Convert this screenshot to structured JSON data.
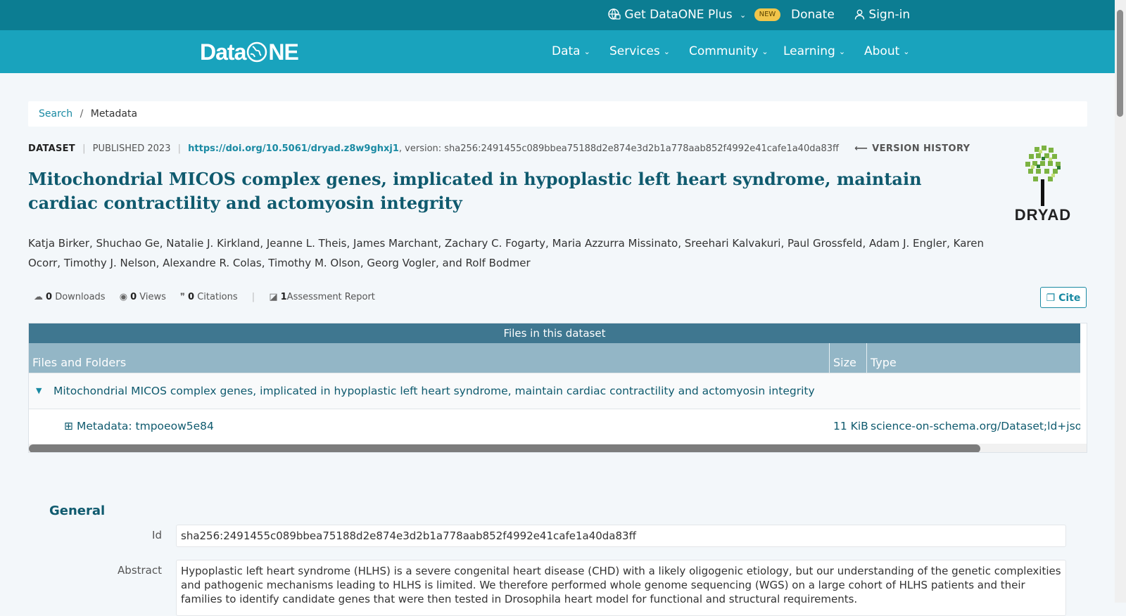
{
  "topbar": {
    "plus_label": "Get DataONE Plus",
    "new_badge": "NEW",
    "donate_label": "Donate",
    "signin_label": "Sign-in"
  },
  "brand": {
    "logo_text_left": "Data",
    "logo_text_right": "NE"
  },
  "nav": {
    "items": [
      {
        "label": "Data"
      },
      {
        "label": "Services"
      },
      {
        "label": "Community"
      },
      {
        "label": "Learning"
      },
      {
        "label": "About"
      }
    ]
  },
  "breadcrumb": {
    "link": "Search",
    "separator": "/",
    "current": "Metadata"
  },
  "meta": {
    "type": "DATASET",
    "published": "PUBLISHED 2023",
    "doi": "https://doi.org/10.5061/dryad.z8w9ghxj1",
    "version": ", version: sha256:2491455c089bbea75188d2e874e3d2b1a778aab852f4992e41cafe1a40da83ff",
    "version_history": "VERSION HISTORY"
  },
  "title": "Mitochondrial MICOS complex genes, implicated in hypoplastic left heart syndrome, maintain cardiac contractility and actomyosin integrity",
  "authors": "Katja Birker, Shuchao Ge, Natalie J. Kirkland, Jeanne L. Theis, James Marchant, Zachary C. Fogarty, Maria Azzurra Missinato, Sreehari Kalvakuri, Paul Grossfeld, Adam J. Engler, Karen Ocorr, Timothy J. Nelson, Alexandre R. Colas, Timothy M. Olson, Georg Vogler, and Rolf Bodmer",
  "repository_logo": {
    "text": "DRYAD"
  },
  "metrics": {
    "downloads": {
      "count": "0",
      "label": "Downloads"
    },
    "views": {
      "count": "0",
      "label": "Views"
    },
    "citations": {
      "count": "0",
      "label": "Citations"
    },
    "assessment": {
      "count": "1",
      "label": "Assessment Report"
    },
    "cite_label": "Cite"
  },
  "files": {
    "caption": "Files in this dataset",
    "columns": [
      "Files and Folders",
      "Size",
      "Type"
    ],
    "folder": "Mitochondrial MICOS complex genes, implicated in hypoplastic left heart syndrome, maintain cardiac contractility and actomyosin integrity",
    "rows": [
      {
        "name": "Metadata: tmpoeow5e84",
        "size": "11 KiB",
        "type": "science-on-schema.org/Dataset;ld+json"
      }
    ]
  },
  "general": {
    "heading": "General",
    "id_label": "Id",
    "id_value": "sha256:2491455c089bbea75188d2e874e3d2b1a778aab852f4992e41cafe1a40da83ff",
    "abstract_label": "Abstract",
    "abstract_value": "Hypoplastic left heart syndrome (HLHS) is a severe congenital heart disease (CHD) with a likely oligogenic etiology, but our understanding of the genetic complexities and pathogenic mechanisms leading to HLHS is limited. We therefore performed whole genome sequencing (WGS) on a large cohort of HLHS patients and their families to identify candidate genes that were then tested in Drosophila heart model for functional and structural requirements."
  },
  "colors": {
    "topbar": "#0c7d92",
    "navbar": "#19a3bd",
    "accent": "#1a8aa3",
    "title": "#0f5a6e",
    "table_caption": "#3f7790",
    "table_header": "#93b6c6"
  }
}
